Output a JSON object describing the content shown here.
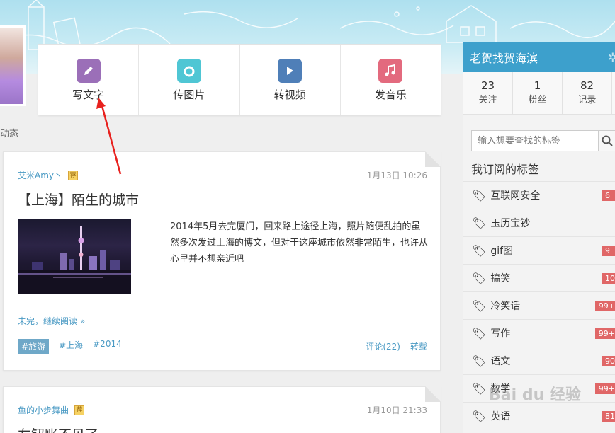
{
  "post_bar": {
    "items": [
      {
        "label": "写文字",
        "icon": "pencil-icon",
        "color": "#9b6fb8"
      },
      {
        "label": "传图片",
        "icon": "camera-icon",
        "color": "#4fc6d4"
      },
      {
        "label": "转视频",
        "icon": "play-icon",
        "color": "#4f7fb8"
      },
      {
        "label": "发音乐",
        "icon": "music-icon",
        "color": "#e36a7e"
      }
    ]
  },
  "feed": {
    "heading": "动态",
    "posts": [
      {
        "author": "艾米Amy丶",
        "badge": "荐",
        "date": "1月13日 10:26",
        "title": "【上海】陌生的城市",
        "excerpt": "2014年5月去完厦门，回来路上途径上海，照片随便乱拍的虽然多次发过上海的博文，但对于这座城市依然非常陌生，也许从心里并不想亲近吧",
        "more": "未完，继续阅读 »",
        "tags": [
          "#旅游",
          "#上海",
          "#2014"
        ],
        "comments": "评论(22)",
        "repost": "转载"
      },
      {
        "author": "鱼的小步舞曲",
        "badge": "荐",
        "date": "1月10日 21:33",
        "title": "左钮账不见了"
      }
    ]
  },
  "sidebar": {
    "username": "老贺找贺海滨",
    "stats": [
      {
        "num": "23",
        "label": "关注"
      },
      {
        "num": "1",
        "label": "粉丝"
      },
      {
        "num": "82",
        "label": "记录"
      }
    ],
    "search_placeholder": "输入想要查找的标签",
    "tags_heading": "我订阅的标签",
    "tags": [
      {
        "name": "互联网安全",
        "count": "6"
      },
      {
        "name": "玉历宝钞",
        "count": ""
      },
      {
        "name": "gif图",
        "count": "9"
      },
      {
        "name": "搞笑",
        "count": "10"
      },
      {
        "name": "冷笑话",
        "count": "99+"
      },
      {
        "name": "写作",
        "count": "99+"
      },
      {
        "name": "语文",
        "count": "90"
      },
      {
        "name": "数学",
        "count": "99+"
      },
      {
        "name": "英语",
        "count": "81"
      }
    ]
  },
  "watermark": "Bai du 经验"
}
